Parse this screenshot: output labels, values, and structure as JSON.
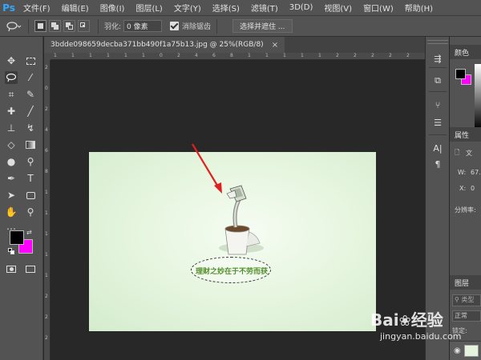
{
  "app": {
    "logo_text": "Ps"
  },
  "menu": {
    "items": [
      "文件(F)",
      "编辑(E)",
      "图像(I)",
      "图层(L)",
      "文字(Y)",
      "选择(S)",
      "滤镜(T)",
      "3D(D)",
      "视图(V)",
      "窗口(W)",
      "帮助(H)"
    ]
  },
  "options": {
    "tool_icon": "lasso-icon",
    "feather_label": "羽化:",
    "feather_value": "0 像素",
    "antialias_checked": true,
    "antialias_label": "消除锯齿",
    "select_mask_label": "选择并遮住 ..."
  },
  "document": {
    "tab_title": "3bdde098659decba371bb490f1a75b13.jpg @ 25%(RGB/8)",
    "close_symbol": "×"
  },
  "rulers": {
    "horizontal": [
      "1",
      "1",
      "1",
      "1",
      "1",
      "1",
      "0",
      "2",
      "4",
      "6",
      "8",
      "1",
      "1",
      "1",
      "1",
      "1",
      "2",
      "2",
      "2",
      "2",
      "2"
    ],
    "vertical": [
      "2",
      "0",
      "2",
      "4",
      "6",
      "8",
      "1",
      "1",
      "1",
      "1",
      "1",
      "2",
      "2",
      "2"
    ]
  },
  "canvas": {
    "slogan": "理财之妙在于不劳而获",
    "background_colors": [
      "#f6fcf3",
      "#e7f6e0",
      "#d4eccd"
    ]
  },
  "colors": {
    "foreground": "#000000",
    "background": "#ff00ff",
    "annotation_arrow": "#e02020"
  },
  "panels": {
    "color_tab": "颜色",
    "properties_tab": "属性",
    "properties_doc_label": "文",
    "prop_w_label": "W:",
    "prop_w_value": "67.",
    "prop_x_label": "X:",
    "prop_x_value": "0",
    "resolution_label": "分辨率:",
    "layers_tab": "图层",
    "layer_search_placeholder": "类型",
    "blend_mode": "正常",
    "lock_label": "锁定:"
  },
  "watermark": {
    "logo_text": "Bai",
    "logo_suffix": "经验",
    "url": "jingyan.baidu.com"
  }
}
